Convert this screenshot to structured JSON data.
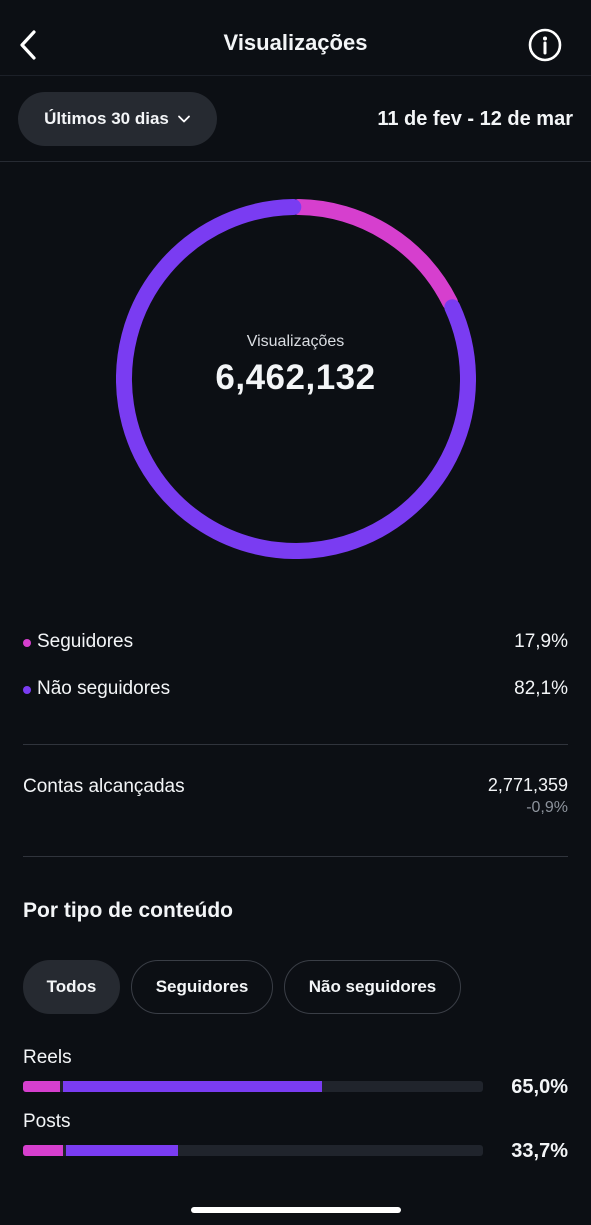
{
  "header": {
    "title": "Visualizações"
  },
  "filter": {
    "range_label": "Últimos 30 dias",
    "date_range": "11 de fev - 12 de mar"
  },
  "summary": {
    "label": "Visualizações",
    "total": "6,462,132"
  },
  "colors": {
    "followers": "#d63fce",
    "non_followers": "#7a3cf2",
    "track": "#20242c"
  },
  "audience": [
    {
      "label": "Seguidores",
      "percent": "17,9%",
      "value": 17.9
    },
    {
      "label": "Não seguidores",
      "percent": "82,1%",
      "value": 82.1
    }
  ],
  "reach": {
    "label": "Contas alcançadas",
    "value": "2,771,359",
    "change": "-0,9%"
  },
  "content_type": {
    "title": "Por tipo de conteúdo",
    "filters": [
      "Todos",
      "Seguidores",
      "Não seguidores"
    ],
    "selected": "Todos",
    "items": [
      {
        "label": "Reels",
        "percent": "65,0%",
        "value": 65.0,
        "followers_share": 8.1,
        "non_followers_share": 56.9
      },
      {
        "label": "Posts",
        "percent": "33,7%",
        "value": 33.7,
        "followers_share": 8.8,
        "non_followers_share": 24.9
      }
    ]
  }
}
